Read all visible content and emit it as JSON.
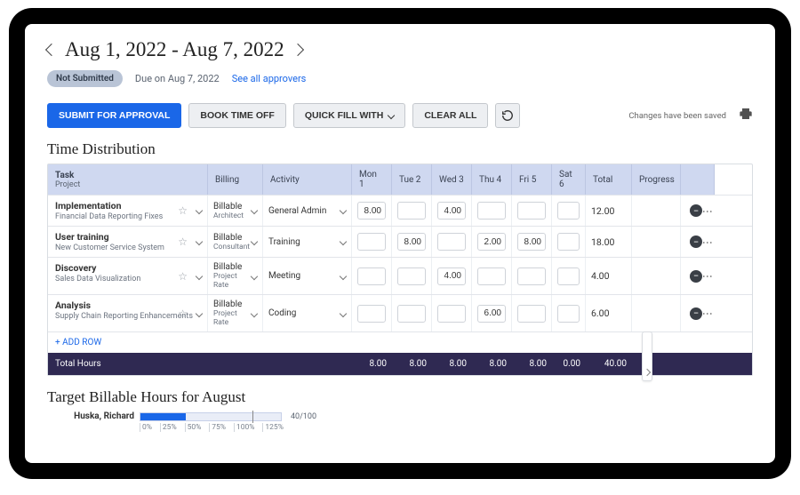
{
  "colors": {
    "accent": "#1a67e8",
    "totals_bg": "#2f2952",
    "header_bg": "#cfd8f0"
  },
  "header": {
    "date_range": "Aug 1, 2022 - Aug 7, 2022",
    "status_label": "Not Submitted",
    "due_label": "Due on Aug 7, 2022",
    "approvers_link": "See all approvers"
  },
  "toolbar": {
    "submit": "SUBMIT FOR APPROVAL",
    "time_off": "BOOK TIME OFF",
    "quick_fill": "QUICK FILL WITH",
    "clear": "CLEAR ALL",
    "save_note": "Changes have been saved"
  },
  "sections": {
    "distribution": "Time Distribution",
    "target": "Target Billable Hours for August"
  },
  "columns": {
    "task": "Task",
    "task_sub": "Project",
    "billing": "Billing",
    "activity": "Activity",
    "d1": "Mon 1",
    "d2": "Tue 2",
    "d3": "Wed 3",
    "d4": "Thu 4",
    "d5": "Fri 5",
    "d6": "Sat 6",
    "total": "Total",
    "progress": "Progress"
  },
  "rows": [
    {
      "task": "Implementation",
      "project": "Financial Data Reporting Fixes",
      "billing": "Billable",
      "role": "Architect",
      "activity": "General Admin",
      "hours": {
        "d1": "8.00",
        "d2": "",
        "d3": "4.00",
        "d4": "",
        "d5": "",
        "d6": ""
      },
      "total": "12.00"
    },
    {
      "task": "User training",
      "project": "New Customer Service System",
      "billing": "Billable",
      "role": "Consultant",
      "activity": "Training",
      "hours": {
        "d1": "",
        "d2": "8.00",
        "d3": "",
        "d4": "2.00",
        "d5": "8.00",
        "d6": ""
      },
      "total": "18.00"
    },
    {
      "task": "Discovery",
      "project": "Sales Data Visualization",
      "billing": "Billable",
      "role": "Project Rate",
      "activity": "Meeting",
      "hours": {
        "d1": "",
        "d2": "",
        "d3": "4.00",
        "d4": "",
        "d5": "",
        "d6": ""
      },
      "total": "4.00"
    },
    {
      "task": "Analysis",
      "project": "Supply Chain Reporting Enhancements",
      "billing": "Billable",
      "role": "Project Rate",
      "activity": "Coding",
      "hours": {
        "d1": "",
        "d2": "",
        "d3": "",
        "d4": "6.00",
        "d5": "",
        "d6": ""
      },
      "total": "6.00"
    }
  ],
  "add_row": "+ ADD ROW",
  "totals": {
    "label": "Total Hours",
    "d1": "8.00",
    "d2": "8.00",
    "d3": "8.00",
    "d4": "8.00",
    "d5": "8.00",
    "d6": "0.00",
    "total": "40.00"
  },
  "chart_data": {
    "type": "bar",
    "orientation": "horizontal",
    "categories": [
      "Huska, Richard"
    ],
    "values": [
      40
    ],
    "target": 100,
    "value_label": "40/100",
    "ticks": [
      "0%",
      "25%",
      "50%",
      "75%",
      "100%",
      "125%"
    ],
    "xlim": [
      0,
      125
    ],
    "title": "Target Billable Hours for August"
  }
}
